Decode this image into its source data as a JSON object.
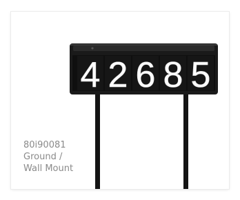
{
  "product": {
    "plaque_digits": [
      "4",
      "2",
      "6",
      "8",
      "5"
    ],
    "caption_lines": [
      "80i90081",
      "Ground /",
      "Wall Mount"
    ]
  },
  "colors": {
    "plaque": "#1a1a1a",
    "digit": "#ffffff",
    "caption": "#8a8a8a",
    "card_border": "#ececec"
  },
  "icons": {
    "product_image": "address-plaque-on-stakes"
  }
}
